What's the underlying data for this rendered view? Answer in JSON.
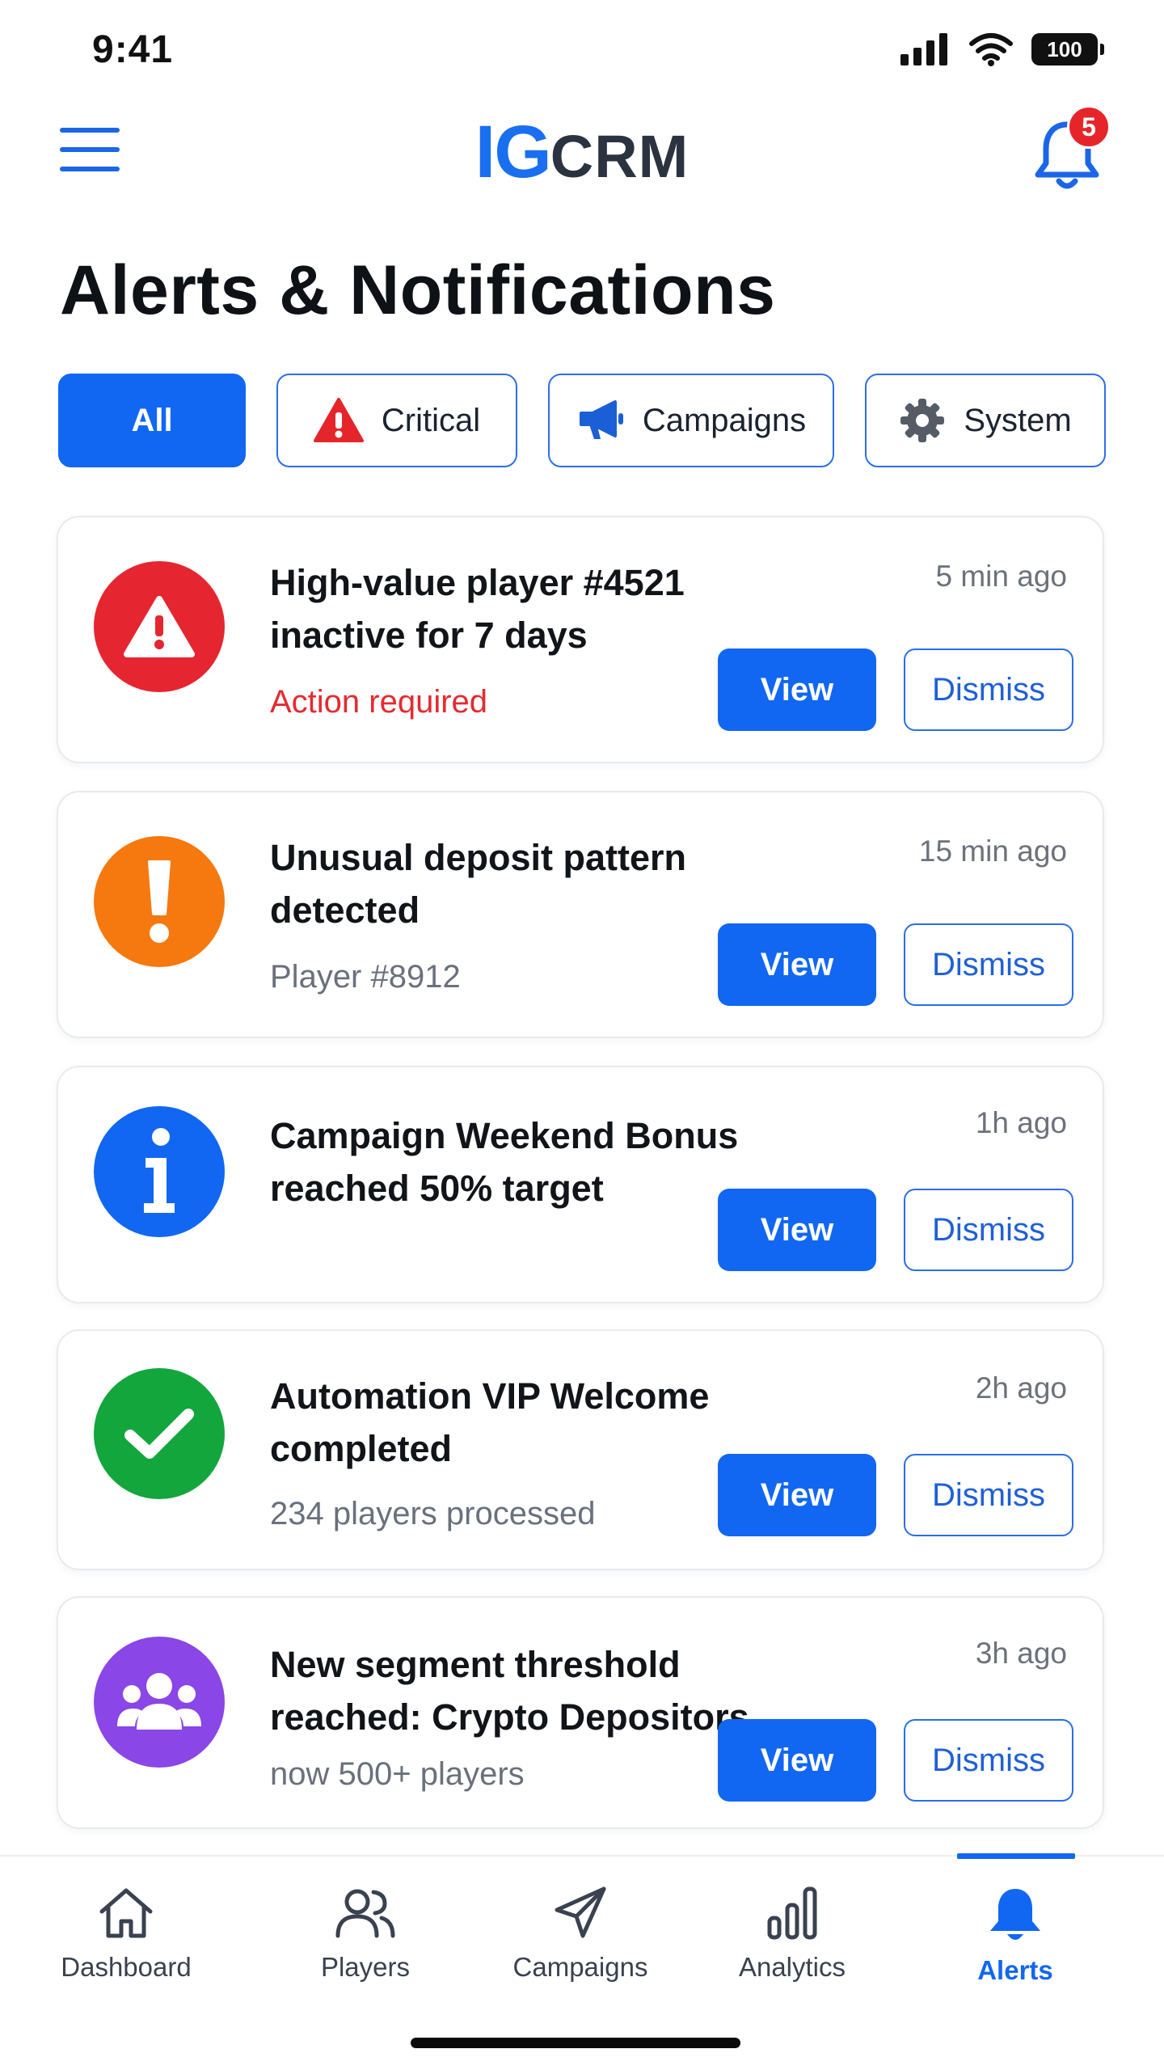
{
  "status_bar": {
    "time": "9:41",
    "battery": "100"
  },
  "header": {
    "logo_ig": "IG",
    "logo_crm": "CRM",
    "notification_count": "5"
  },
  "page": {
    "title": "Alerts & Notifications"
  },
  "filters": [
    {
      "label": "All",
      "icon": "none",
      "active": true
    },
    {
      "label": "Critical",
      "icon": "warning-triangle-icon"
    },
    {
      "label": "Campaigns",
      "icon": "megaphone-icon"
    },
    {
      "label": "System",
      "icon": "gear-icon"
    }
  ],
  "alerts": [
    {
      "title": "High-value player #4521 inactive for 7 days",
      "subtitle": "Action required",
      "time": "5 min ago",
      "icon": "warning-icon",
      "color": "#e52630"
    },
    {
      "title": "Unusual deposit pattern detected",
      "subtitle": "Player #8912",
      "time": "15 min ago",
      "icon": "exclamation-icon",
      "color": "#f5790f"
    },
    {
      "title": "Campaign Weekend Bonus reached 50% target",
      "subtitle": "",
      "time": "1h ago",
      "icon": "info-icon",
      "color": "#1167f2"
    },
    {
      "title": "Automation VIP Welcome completed",
      "subtitle": "234 players processed",
      "time": "2h ago",
      "icon": "check-icon",
      "color": "#13a63d"
    },
    {
      "title": "New segment threshold reached: Crypto Depositors",
      "subtitle": "now 500+ players",
      "time": "3h ago",
      "icon": "users-icon",
      "color": "#8a46e6"
    }
  ],
  "actions": {
    "view": "View",
    "dismiss": "Dismiss"
  },
  "nav": [
    {
      "label": "Dashboard",
      "icon": "home-icon"
    },
    {
      "label": "Players",
      "icon": "players-icon"
    },
    {
      "label": "Campaigns",
      "icon": "paper-plane-icon"
    },
    {
      "label": "Analytics",
      "icon": "bar-chart-icon"
    },
    {
      "label": "Alerts",
      "icon": "bell-icon",
      "active": true
    }
  ]
}
